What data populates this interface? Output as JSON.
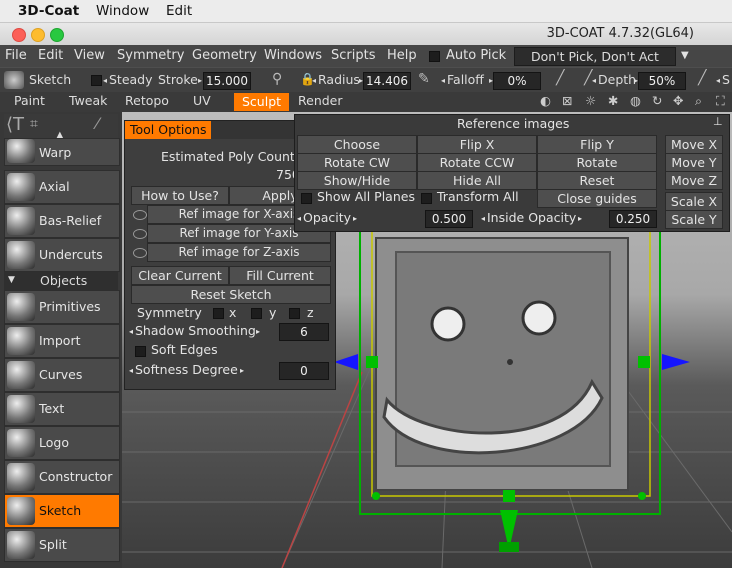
{
  "macmenu": {
    "app": "3D-Coat",
    "window": "Window",
    "edit": "Edit"
  },
  "window": {
    "title": "3D-COAT 4.7.32(GL64)"
  },
  "menu": [
    "File",
    "Edit",
    "View",
    "Symmetry",
    "Geometry",
    "Windows",
    "Scripts",
    "Help"
  ],
  "autopick": {
    "label": "Auto Pick",
    "value": "Don't Pick, Don't Act"
  },
  "toolbar": {
    "tool": "Sketch",
    "steady": "Steady",
    "stroke": "Stroke",
    "stroke_value": "15.000",
    "radius": "Radius",
    "radius_value": "14.406",
    "falloff": "Falloff",
    "falloff_value": "0%",
    "depth": "Depth",
    "depth_value": "50%",
    "cut": "S"
  },
  "rooms": [
    "Paint",
    "Tweak",
    "Retopo",
    "UV",
    "Sculpt",
    "Render"
  ],
  "left": {
    "items": [
      "Warp",
      "Axial",
      "Bas-Relief",
      "Undercuts"
    ],
    "section": "Objects",
    "objects": [
      "Primitives",
      "Import",
      "Curves",
      "Text",
      "Logo",
      "Constructor",
      "Sketch",
      "Split"
    ]
  },
  "tool_options": {
    "title": "Tool Options",
    "poly_label": "Estimated Poly Count",
    "poly_value": "750",
    "how_to_use": "How to Use?",
    "apply": "Apply",
    "ref_x": "Ref image for X-axis",
    "ref_y": "Ref image for Y-axis",
    "ref_z": "Ref image for Z-axis",
    "clear": "Clear Current",
    "fill": "Fill Current",
    "reset": "Reset Sketch",
    "symmetry": "Symmetry",
    "sx": "x",
    "sy": "y",
    "sz": "z",
    "shadow": "Shadow Smoothing",
    "shadow_value": "6",
    "soft_edges": "Soft Edges",
    "softness": "Softness Degree",
    "softness_value": "0"
  },
  "reference": {
    "title": "Reference images",
    "choose": "Choose",
    "flip_x": "Flip  X",
    "flip_y": "Flip  Y",
    "rotate_cw": "Rotate  CW",
    "rotate_ccw": "Rotate  CCW",
    "rotate": "Rotate",
    "showhide": "Show/Hide",
    "hide_all": "Hide  All",
    "reset": "Reset",
    "show_all": "Show  All  Planes",
    "transform_all": "Transform  All",
    "close_guides": "Close  guides",
    "opacity": "Opacity",
    "opacity_value": "0.500",
    "inside": "Inside  Opacity",
    "inside_value": "0.250",
    "move_x": "Move  X",
    "move_y": "Move  Y",
    "move_z": "Move  Z",
    "scale_x": "Scale  X",
    "scale_y": "Scale  Y"
  },
  "colors": {
    "accent": "#ff7a00",
    "panel": "#3e3e3e",
    "gizmo_green": "#00c000",
    "gizmo_blue": "#1010ff"
  }
}
